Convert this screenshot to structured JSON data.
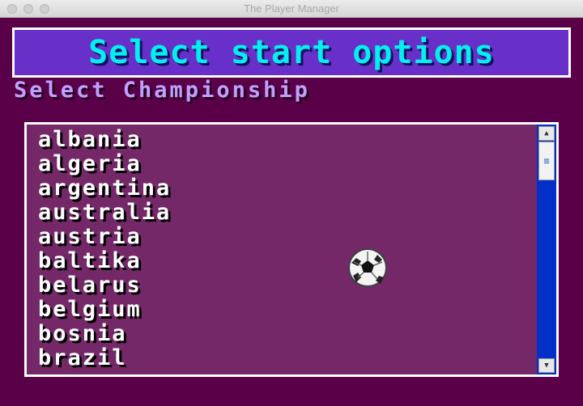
{
  "window": {
    "title": "The Player Manager"
  },
  "header": {
    "title": "Select start options"
  },
  "section": {
    "label": "Select Championship"
  },
  "championships": {
    "items": [
      "albania",
      "algeria",
      "argentina",
      "australia",
      "austria",
      "baltika",
      "belarus",
      "belgium",
      "bosnia",
      "brazil"
    ]
  },
  "icons": {
    "scroll_up": "arrow-up-icon",
    "scroll_down": "arrow-down-icon",
    "thumb_grip": "grip-lines-icon",
    "cursor": "soccer-ball-icon"
  },
  "colors": {
    "background": "#5a0048",
    "banner_fill": "#6830c8",
    "banner_text": "#00f0f0",
    "section_text": "#c0a0ff",
    "list_fill": "#742868",
    "scrollbar": "#0030c8"
  }
}
